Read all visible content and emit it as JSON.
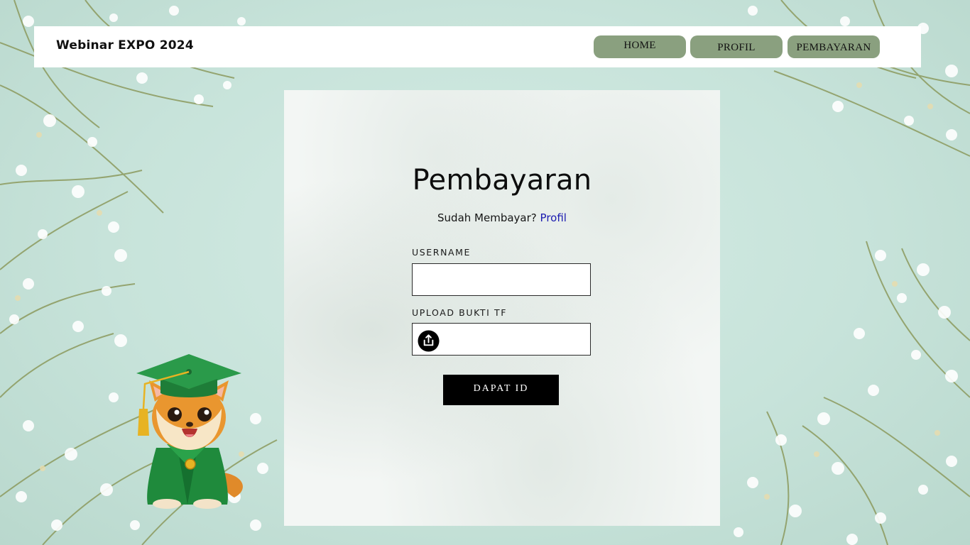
{
  "header": {
    "site_title": "Webinar EXPO 2024",
    "nav": {
      "home": "HOME",
      "profil": "PROFIL",
      "pembayaran": "PEMBAYARAN"
    }
  },
  "form": {
    "title": "Pembayaran",
    "subtitle_text": "Sudah Membayar?",
    "subtitle_link": "Profil",
    "username_label": "USERNAME",
    "username_value": "",
    "upload_label": "UPLOAD BUKTI TF",
    "submit_label": "DAPAT ID"
  },
  "icons": {
    "upload": "upload-icon",
    "mascot": "graduate-cat-mascot"
  },
  "colors": {
    "nav_button": "#8aa07f",
    "link": "#1b1bb0",
    "submit_button": "#000000",
    "background": "#c7e3da"
  }
}
